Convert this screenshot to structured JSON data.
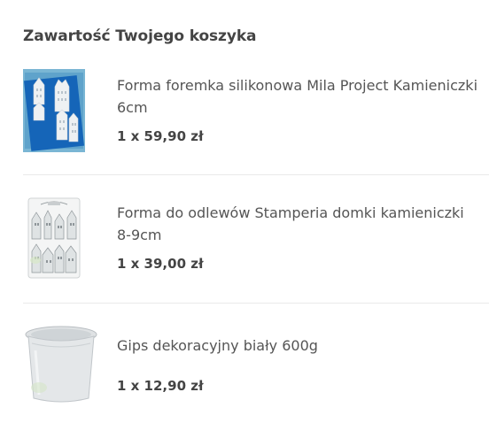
{
  "cart": {
    "title": "Zawartość Twojego koszyka",
    "items": [
      {
        "name": "Forma foremka silikonowa Mila Project Kamieniczki 6cm",
        "quantity_price": "1 x 59,90 zł",
        "thumbnail_icon": "silicone-mold-houses-image"
      },
      {
        "name": "Forma do odlewów Stamperia domki kamieniczki 8-9cm",
        "quantity_price": "1 x 39,00 zł",
        "thumbnail_icon": "stamperia-mold-houses-image"
      },
      {
        "name": "Gips dekoracyjny biały 600g",
        "quantity_price": "1 x 12,90 zł",
        "thumbnail_icon": "plaster-bucket-image"
      }
    ]
  }
}
